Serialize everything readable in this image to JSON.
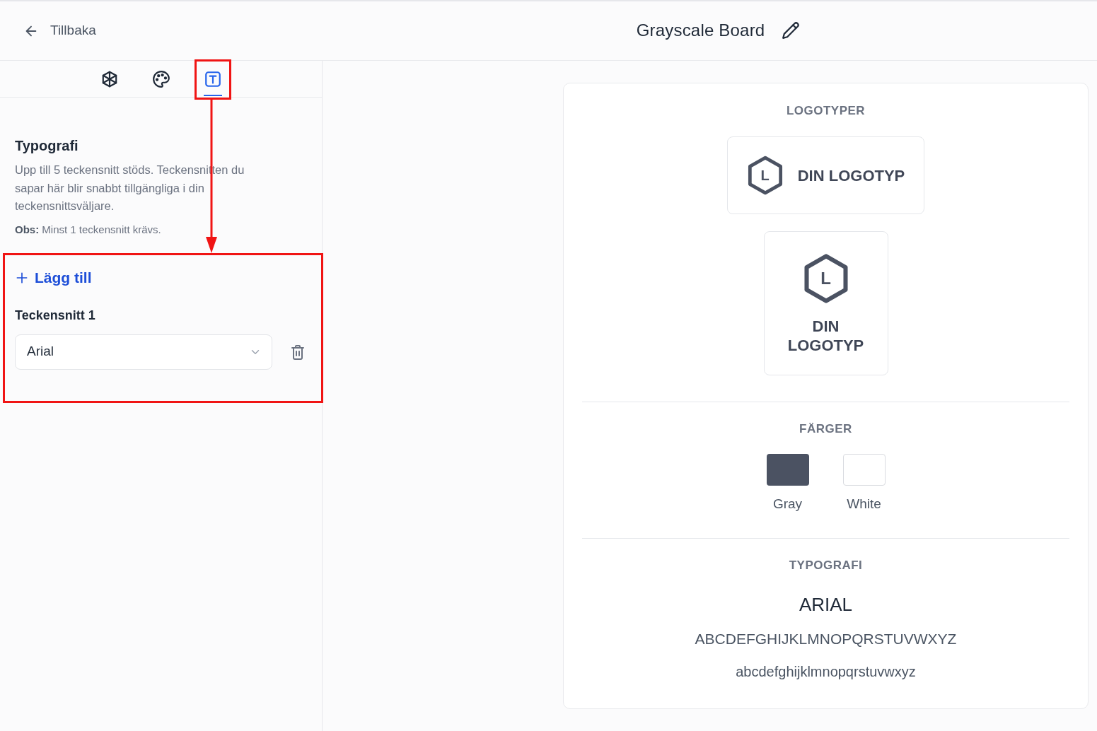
{
  "header": {
    "back_label": "Tillbaka",
    "title": "Grayscale Board"
  },
  "tabs": [
    {
      "kind": "brand",
      "selected": false,
      "highlighted": false
    },
    {
      "kind": "colors",
      "selected": false,
      "highlighted": false
    },
    {
      "kind": "typography",
      "selected": true,
      "highlighted": true
    }
  ],
  "panel": {
    "heading": "Typografi",
    "description": "Upp till 5 teckensnitt stöds. Teckensnitten du sapar här blir snabbt tillgängliga i din teckensnittsväljare.",
    "note": "**Obs:** Minst 1 teckensnitt krävs.",
    "highlighted": true,
    "add_label": "Lägg till",
    "fonts": [
      {
        "label": "Teckensnitt 1",
        "value": "Arial"
      }
    ]
  },
  "annotation_arrow": true,
  "preview": {
    "logos_heading": "LOGOTYPER",
    "logos": [
      {
        "kind": "horizontal",
        "letter": "L",
        "text": "DIN LOGOTYP"
      },
      {
        "kind": "stacked",
        "letter": "L",
        "text": "DIN LOGOTYP"
      }
    ],
    "colors_heading": "FÄRGER",
    "colors": [
      {
        "name": "Gray",
        "color": "#4b5262"
      },
      {
        "name": "White",
        "color": "#ffffff"
      }
    ],
    "typography_heading": "TYPOGRAFI",
    "fonts": [
      {
        "name": "ARIAL",
        "uppercase": "ABCDEFGHIJKLMNOPQRSTUVWXYZ",
        "lowercase": "abcdefghijklmnopqrstuvwxyz"
      }
    ]
  }
}
